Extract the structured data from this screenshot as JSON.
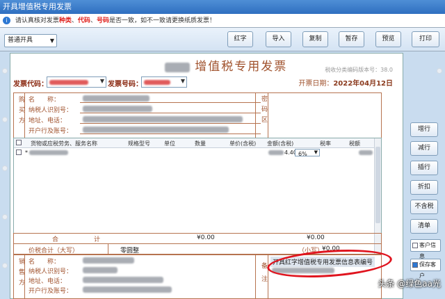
{
  "window": {
    "title": "开具增值税专用发票"
  },
  "notice": {
    "prefix": "请认真核对发票",
    "w1": "种类",
    "sep1": "、",
    "w2": "代码",
    "sep2": "、",
    "w3": "号码",
    "suffix": "是否一致，如不一致请更换纸质发票！"
  },
  "toolbar": {
    "mode": "普通开具",
    "buttons": [
      "红字",
      "导入",
      "复制",
      "暂存",
      "预览",
      "打印"
    ]
  },
  "invoice": {
    "title": "增值税专用发票",
    "version": "税收分类编码版本号：38.0",
    "code_label": "发票代码：",
    "number_label": "发票号码：",
    "date_label": "开票日期：",
    "date_value": "2022年04月12日",
    "buyer": {
      "side": "购买方",
      "fields": [
        "名　　称：",
        "纳税人识别号：",
        "地址、电话：",
        "开户行及账号："
      ],
      "password_area": "密码区"
    },
    "items": {
      "headers": [
        "货物或应税劳务、服务名称",
        "规格型号",
        "单位",
        "数量",
        "单价(含税)",
        "金额(含税)",
        "税率",
        "税额"
      ],
      "row": {
        "name_prefix": "*",
        "amount_suffix": "4.40",
        "tax_rate": "6%"
      }
    },
    "totals": {
      "label_left": "合",
      "label_right": "计",
      "amount": "¥0.00",
      "tax": "¥0.00",
      "price_tax_label": "价税合计（大写）",
      "amount_in_words": "零圆整",
      "small_label": "（小写）",
      "small_value": "¥0.00"
    },
    "seller": {
      "side": "销售方",
      "fields": [
        "名　　称：",
        "纳税人识别号：",
        "地址、电话：",
        "开户行及账号："
      ],
      "remark_label": "备注",
      "remark_text": "开具红字增值税专用发票信息表编号"
    }
  },
  "sidebar": {
    "buttons": [
      "增行",
      "减行",
      "插行",
      "折扣",
      "不含税",
      "清单"
    ],
    "checkboxes": [
      "客户信息",
      "保存客户"
    ]
  },
  "watermark": "头条 @绿色aa光",
  "colors": {
    "accent": "#a0522d",
    "highlight": "#e0141e",
    "titlebar": "#2f6fc0"
  }
}
